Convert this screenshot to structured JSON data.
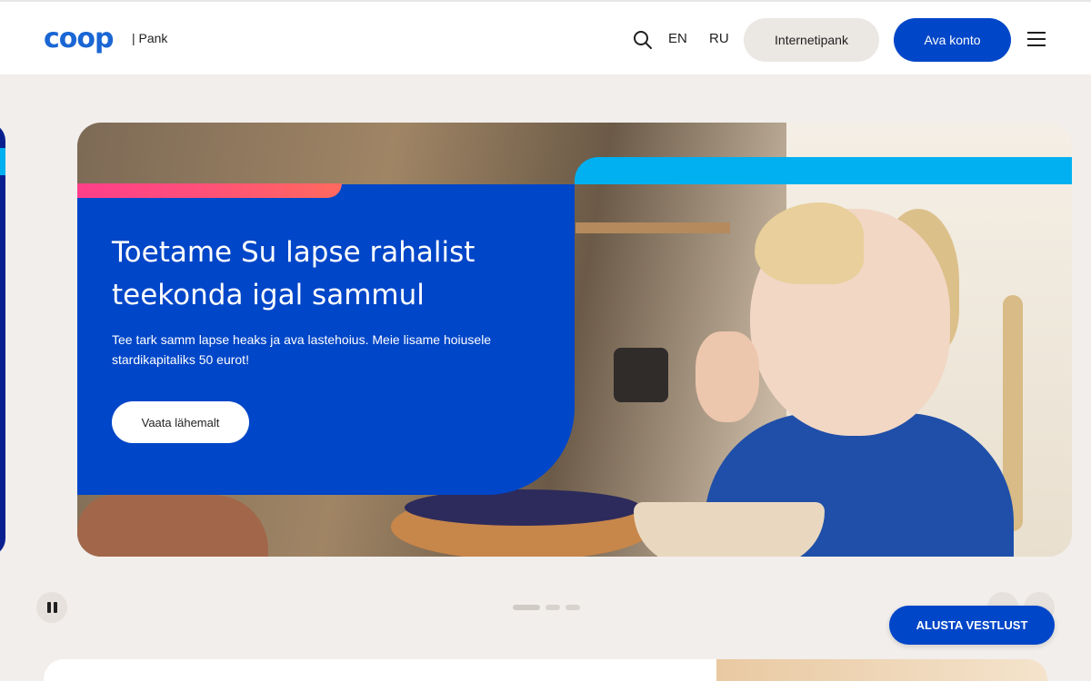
{
  "header": {
    "logo_text": "coop",
    "brand_suffix": "| Pank",
    "search_icon": "search-icon",
    "languages": [
      "EN",
      "RU"
    ],
    "internetbank_label": "Internetipank",
    "open_account_label": "Ava konto",
    "menu_icon": "hamburger-menu-icon"
  },
  "hero": {
    "title": "Toetame Su lapse rahalist teekonda igal sammul",
    "description": "Tee tark samm lapse heaks ja ava lastehoius. Meie lisame hoiusele stardikapitaliks 50 eurot!",
    "cta_label": "Vaata lähemalt"
  },
  "carousel": {
    "pause_icon": "pause-icon",
    "prev_icon": "chevron-left-icon",
    "next_icon": "chevron-right-icon",
    "prev_glyph": "‹",
    "next_glyph": "›",
    "slide_count": 3,
    "active_slide": 1
  },
  "chat": {
    "label": "ALUSTA VESTLUST"
  },
  "colors": {
    "brand_blue": "#0046c8",
    "accent_cyan": "#00b0f0",
    "accent_pink": "#ff3f8a",
    "page_bg": "#f1eeeb"
  }
}
